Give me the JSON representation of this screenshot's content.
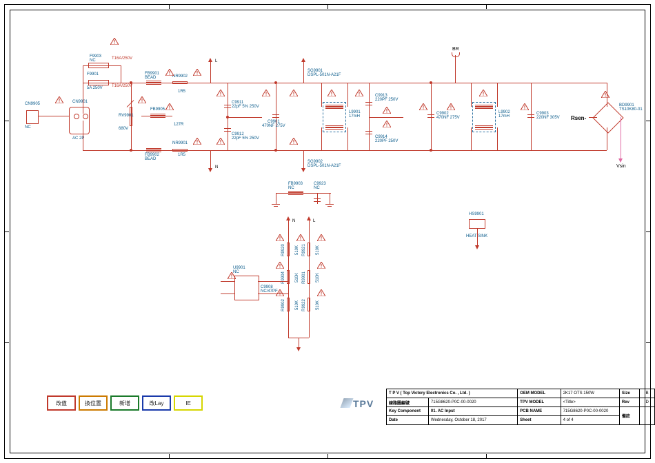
{
  "company": "T P V  ( Top  Victory  Electronics  Co. ,  Ltd. )",
  "title_block": {
    "circuit_label": "線路圖編號",
    "circuit_val": "715G8620-P0C-00-0020",
    "key_comp_label": "Key Component",
    "key_comp_val": "01. AC Input",
    "date_label": "Date",
    "date_val": "Wednesday, October 18, 2017",
    "oem_label": "OEM MODEL",
    "oem_val": "2K17 OTS 150W",
    "tpv_label": "TPV MODEL",
    "tpv_val": "<Title>",
    "pcb_label": "PCB NAME",
    "pcb_val": "715G8620-P0C-00-0020",
    "sheet_label": "Sheet",
    "sheet_val": "4    of    4",
    "size_label": "Size",
    "size_val": "B",
    "rev_label": "Rev",
    "rev_val": "D",
    "note_label": "備註"
  },
  "legend": {
    "l1": "改值",
    "l2": "換位置",
    "l3": "新增",
    "l4": "改Lay",
    "l5": "IE"
  },
  "nets": {
    "L": "L",
    "N": "N",
    "BR": "BR",
    "Rsen": "Rsen-",
    "Vsin": "Vsin"
  },
  "parts": {
    "cn9905": "CN9905",
    "cn9905v": "NC",
    "cn9901": "CN9901",
    "cn9901v": "AC 2P",
    "f9903": "F9903",
    "f9903v": "NC",
    "f9901": "F9901",
    "f9901v": "5A 250V",
    "t1": "T16A/250V",
    "t2": "T16A/250V",
    "rv9901": "RV9901",
    "rv9901v": "680V",
    "fb9901": "FB9901",
    "fb9901v": "BEAD",
    "fb9902": "FB9902",
    "fb9902v": "BEAD",
    "fb9905": "FB9905",
    "nr9902": "NR9902",
    "nr9902v": "1R5",
    "nr9901": "NR9901",
    "nr9901a": "1R5",
    "nr9901b": "127R",
    "c9911": "C9911",
    "c9911v": "22pF 5% 250V",
    "c9912": "C9912",
    "c9912v": "22pF 5% 250V",
    "c9901": "C9901",
    "c9901v": "470NF 275V",
    "sg9901": "SG9901",
    "sg9901v": "DSPL-501N-A21F",
    "sg9902": "SG9902",
    "sg9902v": "DSPL-501N-A21F",
    "l9901": "L9901",
    "l9901v": "17mH",
    "c9913": "C9913",
    "c9913v": "220PF 250V",
    "c9914": "C9914",
    "c9914v": "220PF 250V",
    "c9902": "C9902",
    "c9902v": "470NF 275V",
    "l9902": "L9902",
    "l9902v": "17mH",
    "c9903": "C9903",
    "c9903v": "220NF 305V",
    "bd9901": "BD9901",
    "bd9901v": "TS10K80-01",
    "fb9903": "FB9903",
    "fb9903v": "NC",
    "c9923": "C9923",
    "c9923v": "NC",
    "hs9901": "HS9901",
    "hs9901v": "HEAT SINK",
    "u9901": "U9901",
    "u9901v": "NC",
    "c9908": "C9908",
    "c9908v": "NC/47PF",
    "r9920": "R9920",
    "r9921": "R9921",
    "r9901": "R9901",
    "r9904": "R9904",
    "r9902": "R9902",
    "r9922": "R9922",
    "r510k": "510K"
  },
  "logo": "TPV"
}
